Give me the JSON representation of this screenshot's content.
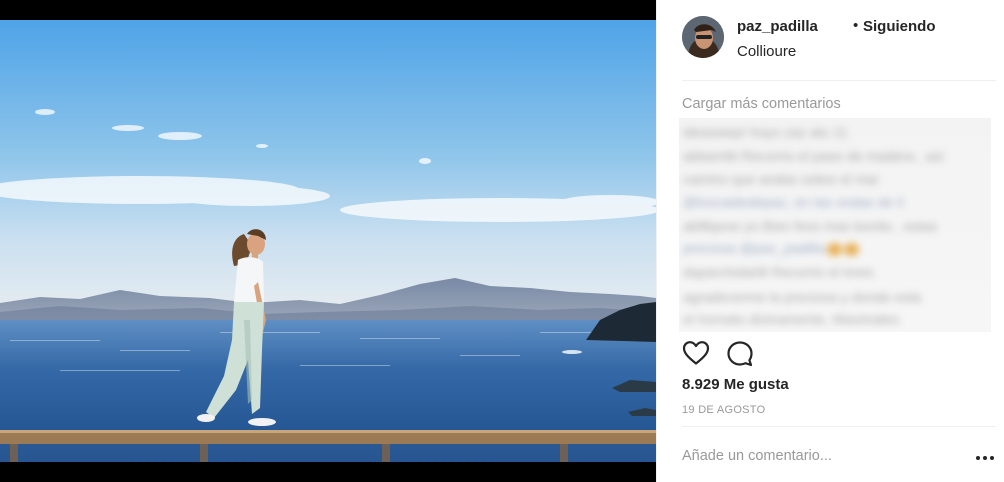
{
  "post": {
    "username": "paz_padilla",
    "separator": "•",
    "follow_status": "Siguiendo",
    "location": "Collioure"
  },
  "comments": {
    "load_more": "Cargar más comentarios",
    "blurred_lines": [
      "ideaswep! hoyo zaz atu 11",
      "abbarrtiti Recorrio el paso de madera , asi",
      "camino que andas sobre el mar",
      "@loscaidodepaz, en las ondas de il",
      "abftbpow yo Bien fess mas bonito , estas",
      "preciosa @paz_padilla",
      "daparchida08 Recorrio el tmes",
      "agradecerme la preciosa y donde esta",
      "el hornato divinamente, Maximales"
    ]
  },
  "actions": {
    "like_icon": "heart-outline-icon",
    "comment_icon": "speech-bubble-icon"
  },
  "likes": "8.929 Me gusta",
  "date": "19 DE AGOSTO",
  "add_comment": {
    "placeholder": "Añade un comentario..."
  },
  "more_options_icon": "more-horizontal-icon",
  "colors": {
    "text": "#262626",
    "muted": "#999999",
    "divider": "#efefef",
    "sky_top": "#5aa7e6",
    "sea": "#2d5b95"
  }
}
